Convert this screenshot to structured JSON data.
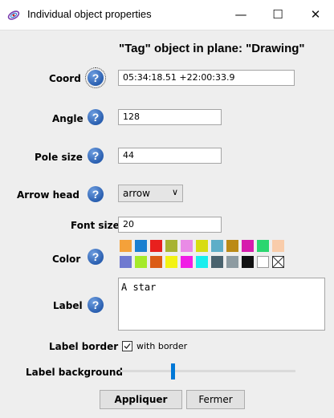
{
  "window": {
    "title": "Individual object properties",
    "minimize": "—",
    "maximize": "☐",
    "close": "✕"
  },
  "header": {
    "subtitle": "\"Tag\" object in plane: \"Drawing\""
  },
  "fields": {
    "coord": {
      "label": "Coord",
      "value": "05:34:18.51 +22:00:33.9"
    },
    "angle": {
      "label": "Angle",
      "value": "128"
    },
    "pole_size": {
      "label": "Pole size",
      "value": "44"
    },
    "arrow_head": {
      "label": "Arrow head",
      "value": "arrow"
    },
    "font_size": {
      "label": "Font size",
      "value": "20"
    },
    "color": {
      "label": "Color"
    },
    "label": {
      "label": "Label",
      "value": "A star"
    },
    "label_border": {
      "label": "Label border",
      "option": "with border",
      "checked": true
    },
    "label_background": {
      "label": "Label background",
      "level": 0.3
    }
  },
  "help_glyph": "?",
  "palette": {
    "row1": [
      "#f4a13a",
      "#1a7fd0",
      "#e8201e",
      "#a7b332",
      "#e98be6",
      "#d8dc10",
      "#5eaec8",
      "#bb8a16",
      "#d61cad",
      "#2ad66f",
      "#f9ccaa"
    ],
    "row2": [
      "#6f79d0",
      "#a5ea2a",
      "#db5c16",
      "#f3f314",
      "#f01ee5",
      "#19eeee",
      "#4a636e",
      "#8d9ba1",
      "#111111",
      "#ffffff",
      "none"
    ]
  },
  "buttons": {
    "apply": "Appliquer",
    "close": "Fermer"
  }
}
